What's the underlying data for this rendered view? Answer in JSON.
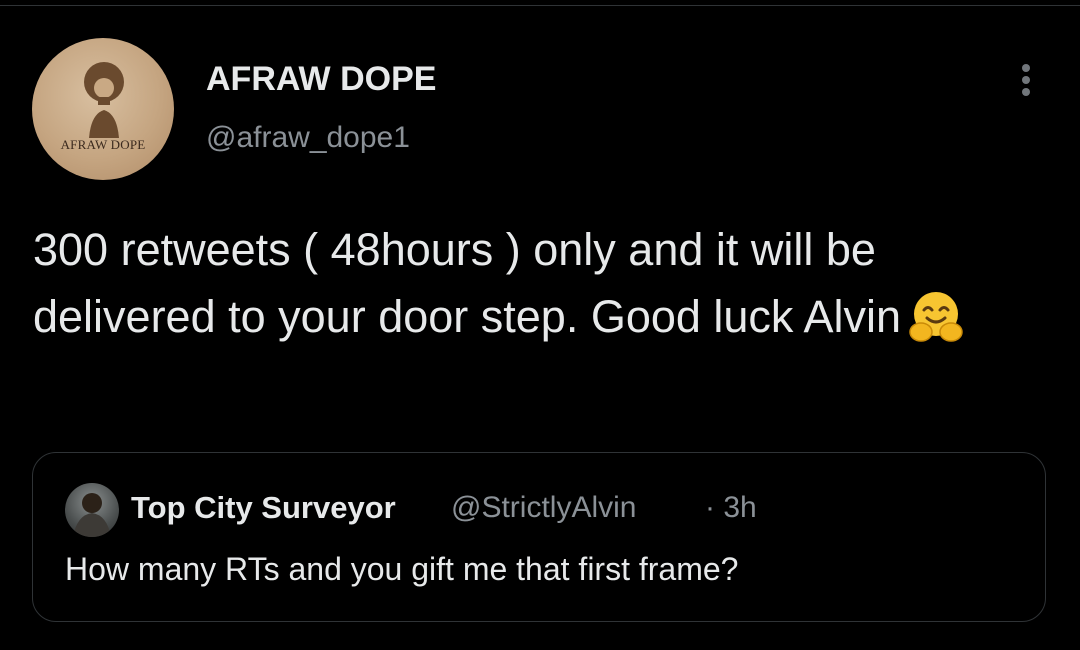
{
  "tweet": {
    "avatar_text": "AFRAW DOPE",
    "display_name": "AFRAW DOPE",
    "handle": "@afraw_dope1",
    "text": "300 retweets ( 48hours ) only and it will be delivered to your door step. Good luck Alvin",
    "emoji": "hugging-face-emoji",
    "more_icon": "more-vertical-icon"
  },
  "quoted_tweet": {
    "display_name": "Top City Surveyor",
    "handle": "@StrictlyAlvin",
    "time": "· 3h",
    "text": "How many RTs and you gift me that first frame?"
  },
  "colors": {
    "background": "#000000",
    "primary_text": "#e7e9ea",
    "secondary_text": "#8b9197",
    "border": "#2f3336",
    "emoji_yellow": "#f7c531"
  }
}
